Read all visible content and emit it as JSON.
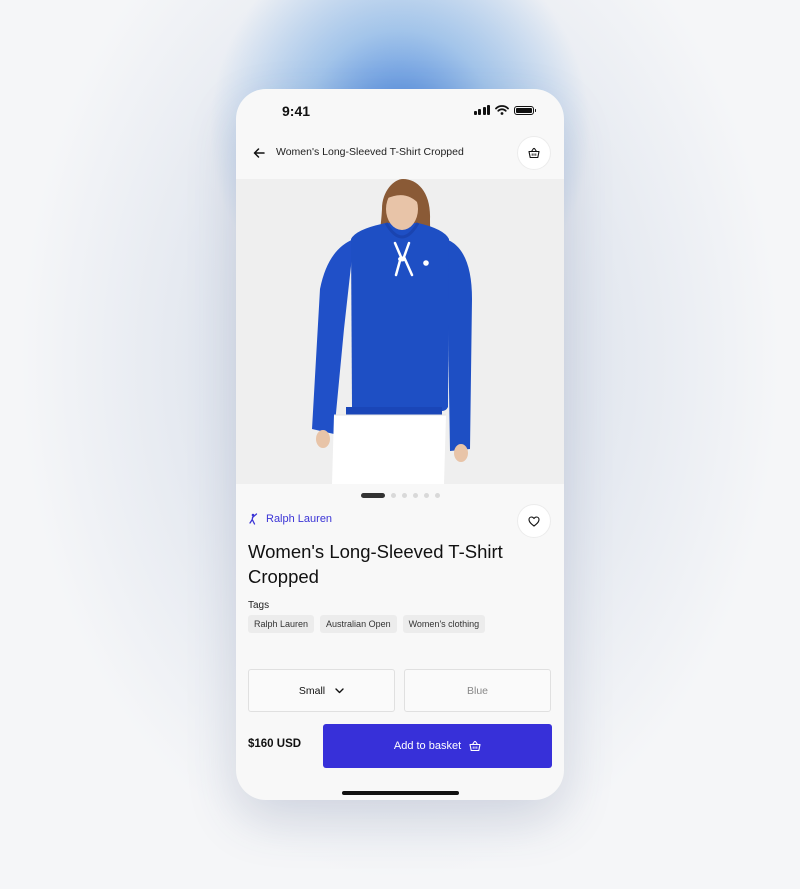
{
  "status_bar": {
    "time": "9:41"
  },
  "header": {
    "title": "Women's Long-Sleeved T-Shirt Cropped"
  },
  "icons": {
    "back": "arrow-left-icon",
    "basket": "basket-icon",
    "favorite": "heart-icon",
    "brand_logo": "polo-player-icon",
    "dropdown": "chevron-down-icon"
  },
  "product": {
    "brand": "Ralph Lauren",
    "title": "Women's Long-Sleeved T-Shirt Cropped",
    "tags_label": "Tags",
    "tags": [
      "Ralph Lauren",
      "Australian Open",
      "Women's clothing"
    ],
    "image_carousel": {
      "count": 6,
      "active_index": 0
    },
    "size": "Small",
    "color": "Blue",
    "price": "$160 USD"
  },
  "actions": {
    "add_to_basket": "Add to basket"
  },
  "colors": {
    "accent": "#3730d9",
    "brand_text": "#3b34d6",
    "hoodie": "#1e4fc4",
    "background": "#f5f6f8"
  }
}
